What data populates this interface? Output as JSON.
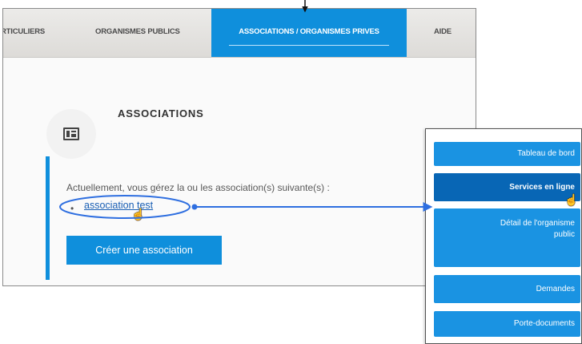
{
  "nav": {
    "items": [
      {
        "label": "RTICULIERS"
      },
      {
        "label": "ORGANISMES PUBLICS"
      },
      {
        "label": "ASSOCIATIONS / ORGANISMES PRIVES"
      },
      {
        "label": "AIDE"
      }
    ],
    "active_index": 2
  },
  "section": {
    "title": "ASSOCIATIONS",
    "intro": "Actuellement, vous gérez la ou les association(s) suivante(s) :",
    "associations": [
      "association test"
    ],
    "create_label": "Créer une association"
  },
  "side_menu": {
    "items": [
      {
        "label": "Tableau de bord"
      },
      {
        "label": "Services en ligne",
        "selected": true
      },
      {
        "label_line1": "Détail de l'organisme",
        "label_line2": "public"
      },
      {
        "label": "Demandes"
      },
      {
        "label": "Porte-documents"
      }
    ]
  },
  "colors": {
    "accent": "#0f8fdc",
    "selected": "#0866b5",
    "callout": "#2f6fe0",
    "link": "#1a5fb4"
  },
  "icons": [
    "id-card-icon",
    "hand-cursor-icon",
    "arrow-down-icon",
    "arrow-right-icon"
  ]
}
